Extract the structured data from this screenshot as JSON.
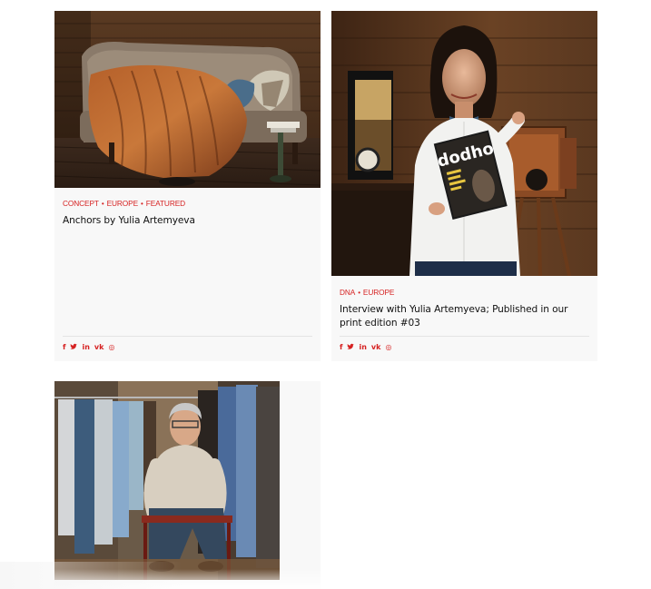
{
  "posts": [
    {
      "categories": [
        "CONCEPT",
        "EUROPE",
        "FEATURED"
      ],
      "title": "Anchors by Yulia Artemyeva",
      "image": "sofa-with-blanket-photo"
    },
    {
      "categories": [
        "DNA",
        "EUROPE"
      ],
      "title": "Interview with Yulia Artemyeva; Published in our print edition #03",
      "image": "woman-with-magazine-and-camera-photo",
      "magazine_logo": "dodho"
    },
    {
      "categories": [],
      "title": "",
      "image": "man-in-wardrobe-photo"
    }
  ],
  "share_icons": [
    "facebook-icon",
    "twitter-icon",
    "linkedin-icon",
    "vk-icon",
    "whatsapp-icon"
  ],
  "share_glyphs": [
    "f",
    "🐦",
    "in",
    "vk",
    "◎"
  ],
  "colors": {
    "accent": "#d62222",
    "card_bg": "#f8f8f8",
    "divider": "#e4e4e4"
  }
}
